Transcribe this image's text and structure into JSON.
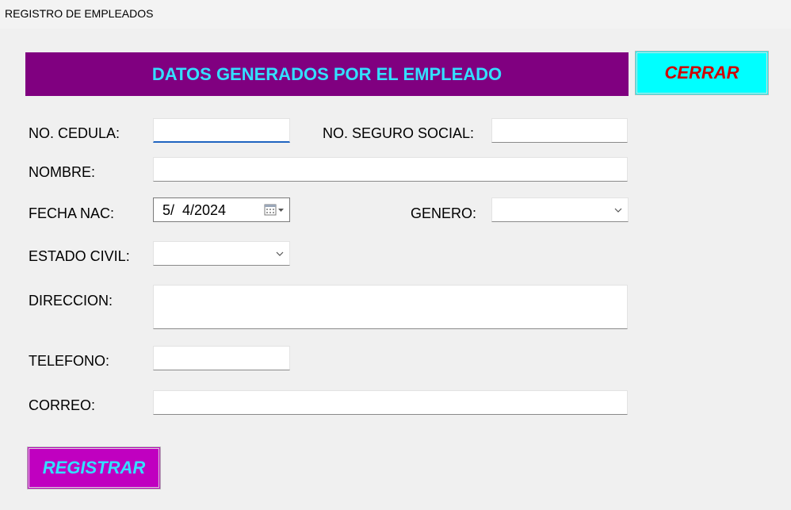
{
  "window": {
    "title": "REGISTRO DE EMPLEADOS"
  },
  "header": {
    "title": "DATOS GENERADOS POR EL EMPLEADO",
    "bg_color": "#800080",
    "text_color": "#33e0ff"
  },
  "buttons": {
    "close_label": "CERRAR",
    "register_label": "REGISTRAR",
    "close_bg": "#00ffff",
    "close_text": "#d00000",
    "register_bg": "#c000c0",
    "register_text": "#33e0ff"
  },
  "form": {
    "cedula": {
      "label": "NO. CEDULA:",
      "value": ""
    },
    "seguro": {
      "label": "NO. SEGURO SOCIAL:",
      "value": ""
    },
    "nombre": {
      "label": "NOMBRE:",
      "value": ""
    },
    "fecha": {
      "label": "FECHA NAC:",
      "value": "5/  4/2024"
    },
    "genero": {
      "label": "GENERO:",
      "value": ""
    },
    "estado_civil": {
      "label": "ESTADO CIVIL:",
      "value": ""
    },
    "direccion": {
      "label": "DIRECCION:",
      "value": ""
    },
    "telefono": {
      "label": "TELEFONO:",
      "value": ""
    },
    "correo": {
      "label": "CORREO:",
      "value": ""
    }
  },
  "icons": {
    "calendar": "calendar-icon",
    "dropdown": "chevron-down-icon"
  }
}
